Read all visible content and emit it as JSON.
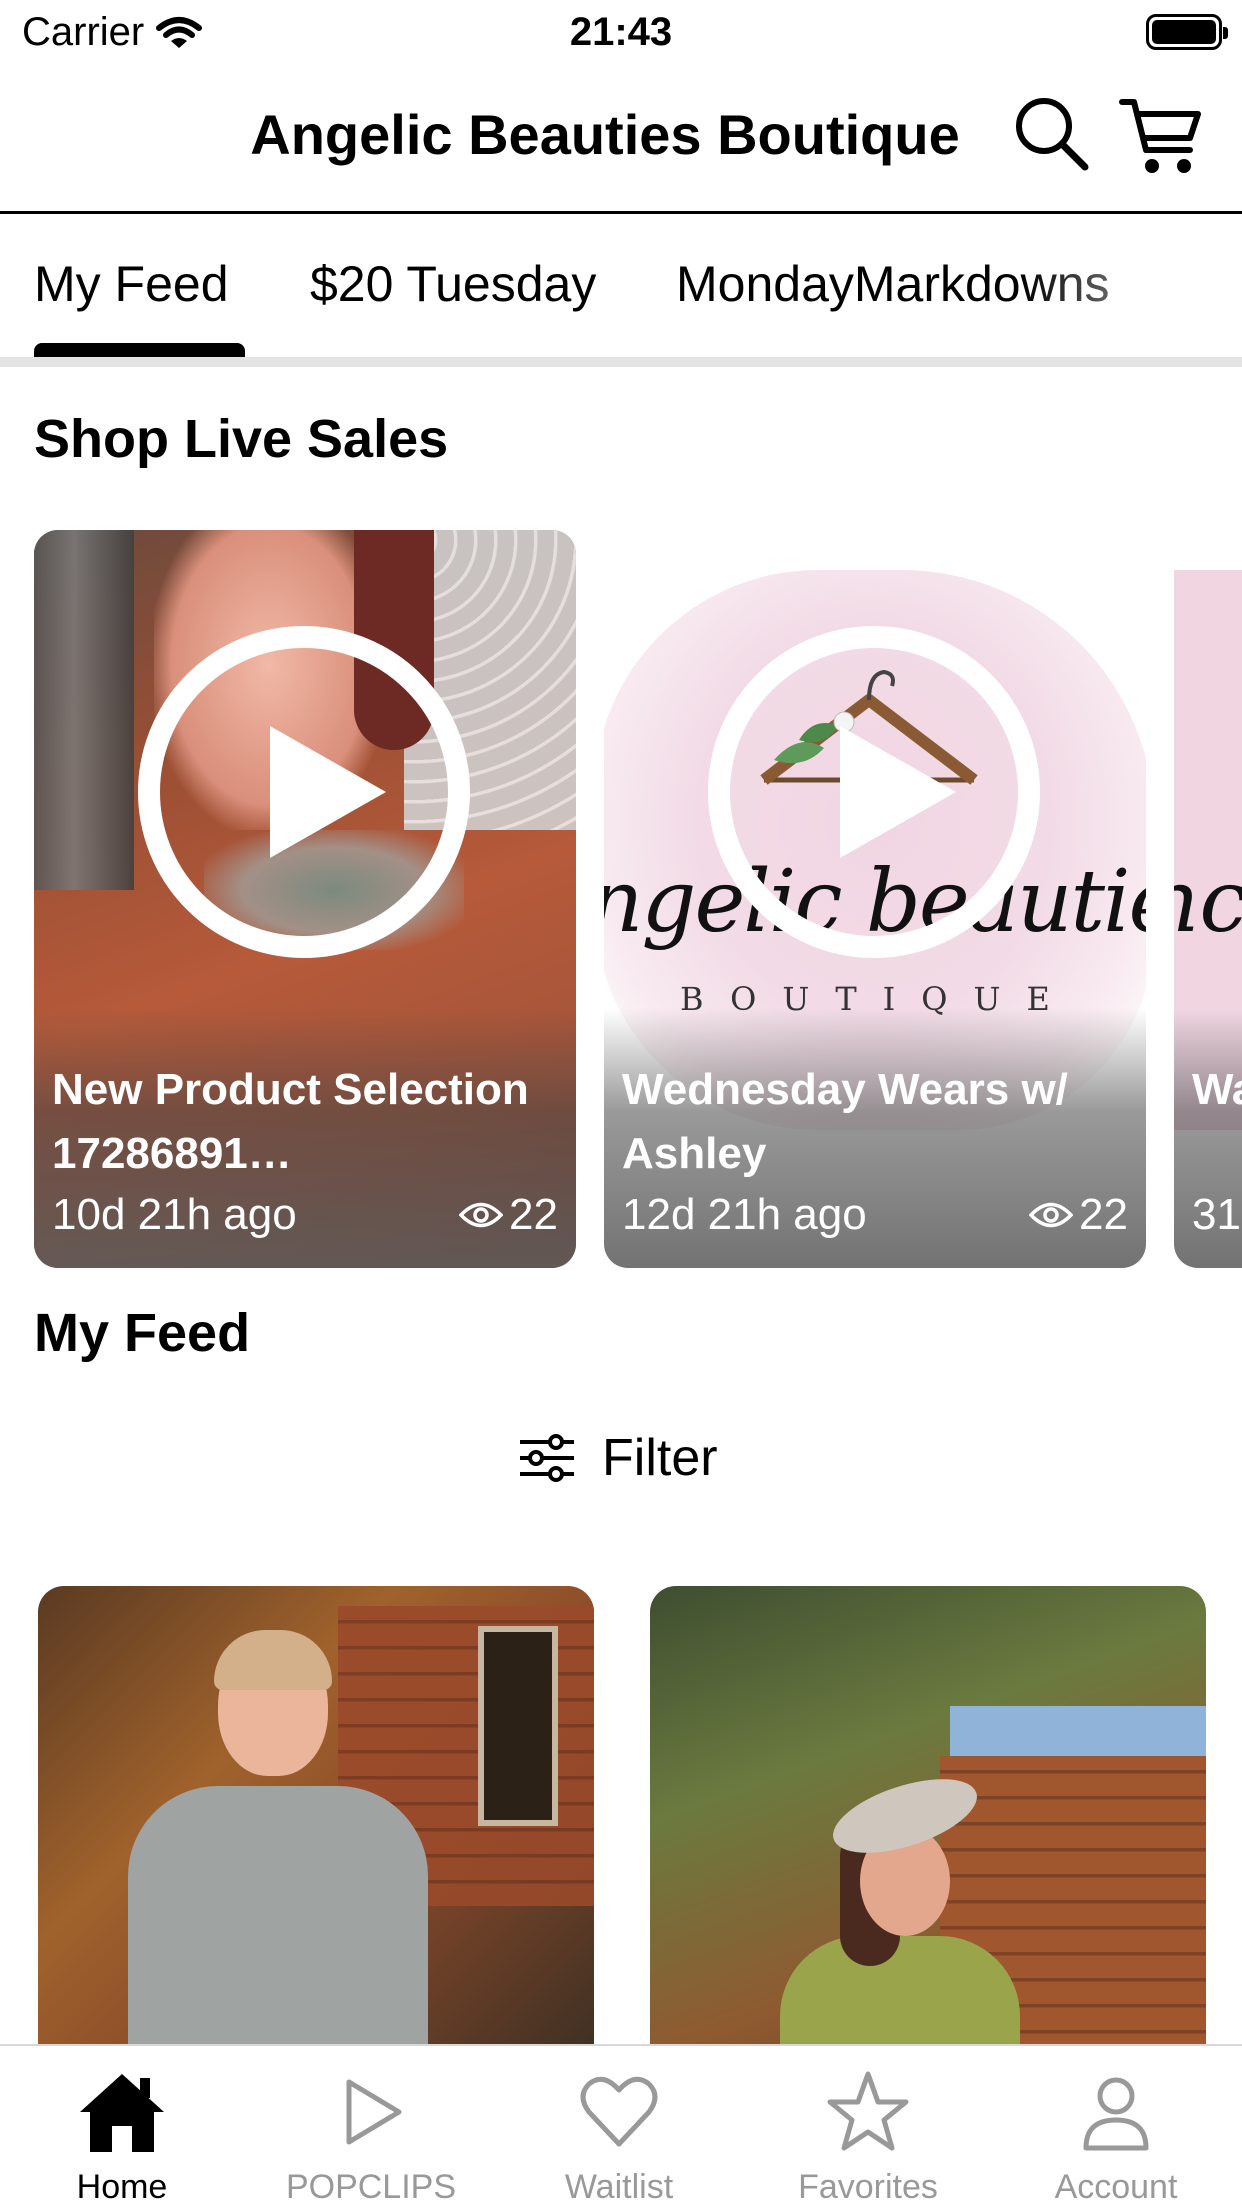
{
  "status_bar": {
    "carrier": "Carrier",
    "time": "21:43"
  },
  "header": {
    "title": "Angelic Beauties Boutique",
    "search_icon": "search-icon",
    "cart_icon": "cart-icon"
  },
  "tabs": [
    {
      "label": "My Feed",
      "active": true
    },
    {
      "label": "$20 Tuesday",
      "active": false
    },
    {
      "label": "MondayMarkdowns",
      "active": false
    }
  ],
  "live_sales": {
    "title": "Shop Live Sales",
    "cards": [
      {
        "title": "New Product Selection 17286891…",
        "time": "10d 21h ago",
        "views": "22"
      },
      {
        "title": "Wednesday Wears w/ Ashley",
        "logo_script": "ngelic beauties",
        "logo_sub": "BOUTIQUE",
        "time": "12d 21h ago",
        "views": "22"
      },
      {
        "title": "Wa",
        "logo_script": "nc",
        "time": "31"
      }
    ]
  },
  "feed": {
    "title": "My Feed",
    "filter_label": "Filter"
  },
  "tabbar": [
    {
      "label": "Home",
      "icon": "home-icon",
      "active": true
    },
    {
      "label": "POPCLIPS",
      "icon": "play-icon",
      "active": false
    },
    {
      "label": "Waitlist",
      "icon": "heart-icon",
      "active": false
    },
    {
      "label": "Favorites",
      "icon": "star-icon",
      "active": false
    },
    {
      "label": "Account",
      "icon": "person-icon",
      "active": false
    }
  ],
  "colors": {
    "text": "#000000",
    "inactive": "#999999",
    "divider": "#e3e3e3"
  }
}
